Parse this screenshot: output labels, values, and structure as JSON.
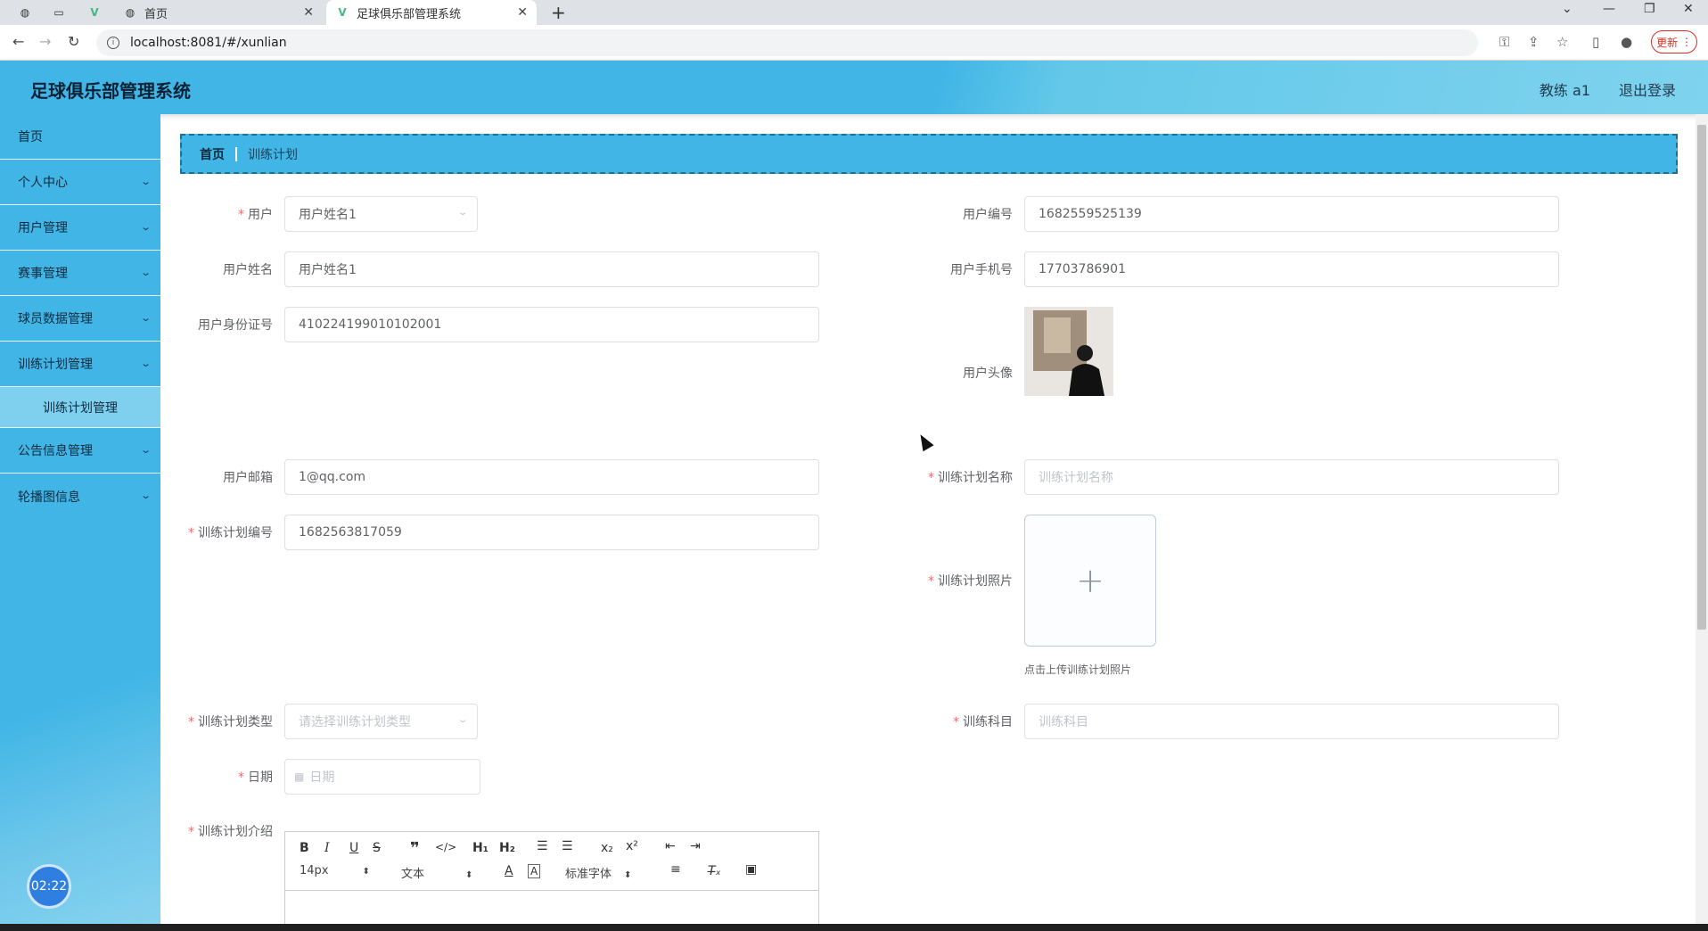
{
  "browser": {
    "tabs": [
      {
        "title": "首页",
        "active": false
      },
      {
        "title": "足球俱乐部管理系统",
        "active": true
      }
    ],
    "url": "localhost:8081/#/xunlian",
    "update_label": "更新"
  },
  "header": {
    "title": "足球俱乐部管理系统",
    "user": "教练 a1",
    "logout": "退出登录"
  },
  "sidebar": {
    "items": [
      {
        "label": "首页"
      },
      {
        "label": "个人中心"
      },
      {
        "label": "用户管理"
      },
      {
        "label": "赛事管理"
      },
      {
        "label": "球员数据管理"
      },
      {
        "label": "训练计划管理"
      },
      {
        "label": "公告信息管理"
      },
      {
        "label": "轮播图信息"
      }
    ],
    "sub_item": "训练计划管理",
    "clock": "02:22"
  },
  "breadcrumb": {
    "home": "首页",
    "current": "训练计划"
  },
  "form": {
    "user": {
      "label": "用户",
      "value": "用户姓名1"
    },
    "user_no": {
      "label": "用户编号",
      "value": "1682559525139"
    },
    "user_name": {
      "label": "用户姓名",
      "value": "用户姓名1"
    },
    "user_phone": {
      "label": "用户手机号",
      "value": "17703786901"
    },
    "user_id": {
      "label": "用户身份证号",
      "value": "410224199010102001"
    },
    "user_avatar": {
      "label": "用户头像"
    },
    "user_email": {
      "label": "用户邮箱",
      "value": "1@qq.com"
    },
    "plan_name": {
      "label": "训练计划名称",
      "placeholder": "训练计划名称"
    },
    "plan_no": {
      "label": "训练计划编号",
      "value": "1682563817059"
    },
    "plan_photo": {
      "label": "训练计划照片",
      "tip": "点击上传训练计划照片"
    },
    "plan_type": {
      "label": "训练计划类型",
      "placeholder": "请选择训练计划类型"
    },
    "subject": {
      "label": "训练科目",
      "placeholder": "训练科目"
    },
    "date": {
      "label": "日期",
      "placeholder": "日期"
    },
    "intro": {
      "label": "训练计划介绍"
    }
  },
  "editor": {
    "font_size": "14px",
    "block_type": "文本",
    "font_family": "标准字体"
  }
}
